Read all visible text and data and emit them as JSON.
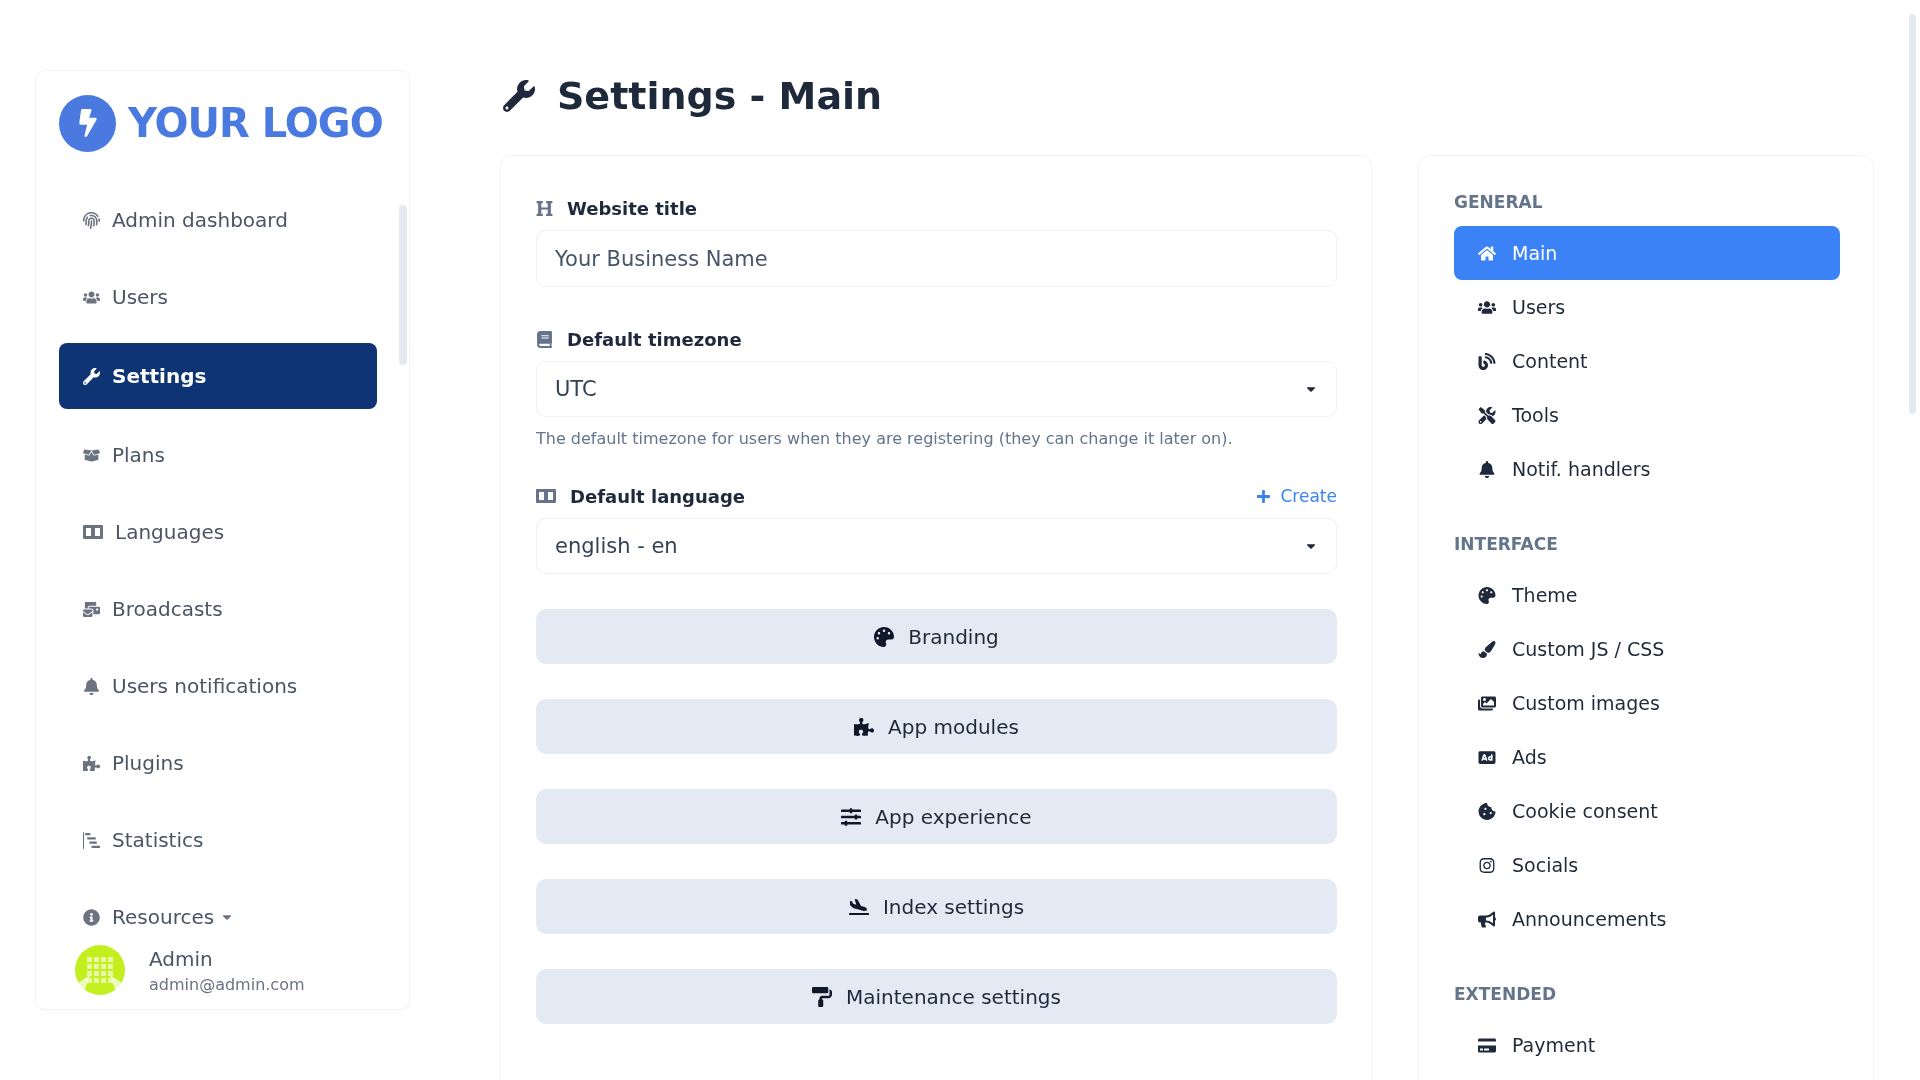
{
  "logo": {
    "text": "YOUR LOGO"
  },
  "sidebar": {
    "items": [
      {
        "label": "Admin dashboard",
        "selected": false
      },
      {
        "label": "Users",
        "selected": false
      },
      {
        "label": "Settings",
        "selected": true
      },
      {
        "label": "Plans",
        "selected": false
      },
      {
        "label": "Languages",
        "selected": false
      },
      {
        "label": "Broadcasts",
        "selected": false
      },
      {
        "label": "Users notifications",
        "selected": false
      },
      {
        "label": "Plugins",
        "selected": false
      },
      {
        "label": "Statistics",
        "selected": false
      },
      {
        "label": "Resources",
        "selected": false,
        "dropdown": true
      }
    ],
    "user": {
      "name": "Admin",
      "email": "admin@admin.com"
    }
  },
  "page_title": "Settings - Main",
  "form": {
    "fields": [
      {
        "label": "Website title",
        "kind": "text",
        "value": "Your Business Name"
      },
      {
        "label": "Default timezone",
        "kind": "select",
        "value": "UTC",
        "help": "The default timezone for users when they are registering (they can change it later on)."
      },
      {
        "label": "Default language",
        "kind": "select",
        "value": "english - en",
        "action": "Create"
      }
    ],
    "buttons": [
      "Branding",
      "App modules",
      "App experience",
      "Index settings",
      "Maintenance settings"
    ]
  },
  "settings_nav": {
    "sections": [
      {
        "heading": "GENERAL",
        "items": [
          {
            "label": "Main",
            "selected": true
          },
          {
            "label": "Users",
            "selected": false
          },
          {
            "label": "Content",
            "selected": false
          },
          {
            "label": "Tools",
            "selected": false
          },
          {
            "label": "Notif. handlers",
            "selected": false
          }
        ]
      },
      {
        "heading": "INTERFACE",
        "items": [
          {
            "label": "Theme",
            "selected": false
          },
          {
            "label": "Custom JS / CSS",
            "selected": false
          },
          {
            "label": "Custom images",
            "selected": false
          },
          {
            "label": "Ads",
            "selected": false
          },
          {
            "label": "Cookie consent",
            "selected": false
          },
          {
            "label": "Socials",
            "selected": false
          },
          {
            "label": "Announcements",
            "selected": false
          }
        ]
      },
      {
        "heading": "EXTENDED",
        "items": [
          {
            "label": "Payment",
            "selected": false
          }
        ]
      }
    ]
  }
}
